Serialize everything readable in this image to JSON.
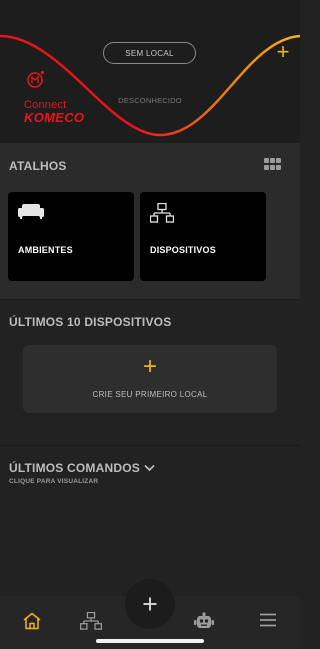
{
  "header": {
    "location_pill": "SEM LOCAL",
    "status_text": "DESCONHECIDO",
    "add_icon": "plus-icon",
    "logo": {
      "connect": "Connect",
      "brand": "KOMECO"
    },
    "colors": {
      "wave_red": "#e8141a",
      "wave_orange": "#f39200",
      "accent": "#f6b21b"
    }
  },
  "shortcuts": {
    "title": "ATALHOS",
    "view_icon": "grid-icon",
    "cards": [
      {
        "label": "AMBIENTES",
        "icon": "sofa-icon"
      },
      {
        "label": "DISPOSITIVOS",
        "icon": "network-icon"
      }
    ]
  },
  "recent_devices": {
    "title": "ÚLTIMOS 10 DISPOSITIVOS",
    "empty_action": "CRIE SEU PRIMEIRO LOCAL",
    "empty_icon": "plus-icon"
  },
  "recent_commands": {
    "title": "ÚLTIMOS COMANDOS",
    "subtitle": "CLIQUE PARA VISUALIZAR",
    "toggle_icon": "chevron-down-icon"
  },
  "tabbar": {
    "items": [
      {
        "icon": "home-icon",
        "active": true
      },
      {
        "icon": "network-icon",
        "active": false
      },
      {
        "icon": "plus-icon",
        "active": false
      },
      {
        "icon": "robot-icon",
        "active": false
      },
      {
        "icon": "menu-icon",
        "active": false
      }
    ],
    "active_color": "#f6b21b"
  }
}
